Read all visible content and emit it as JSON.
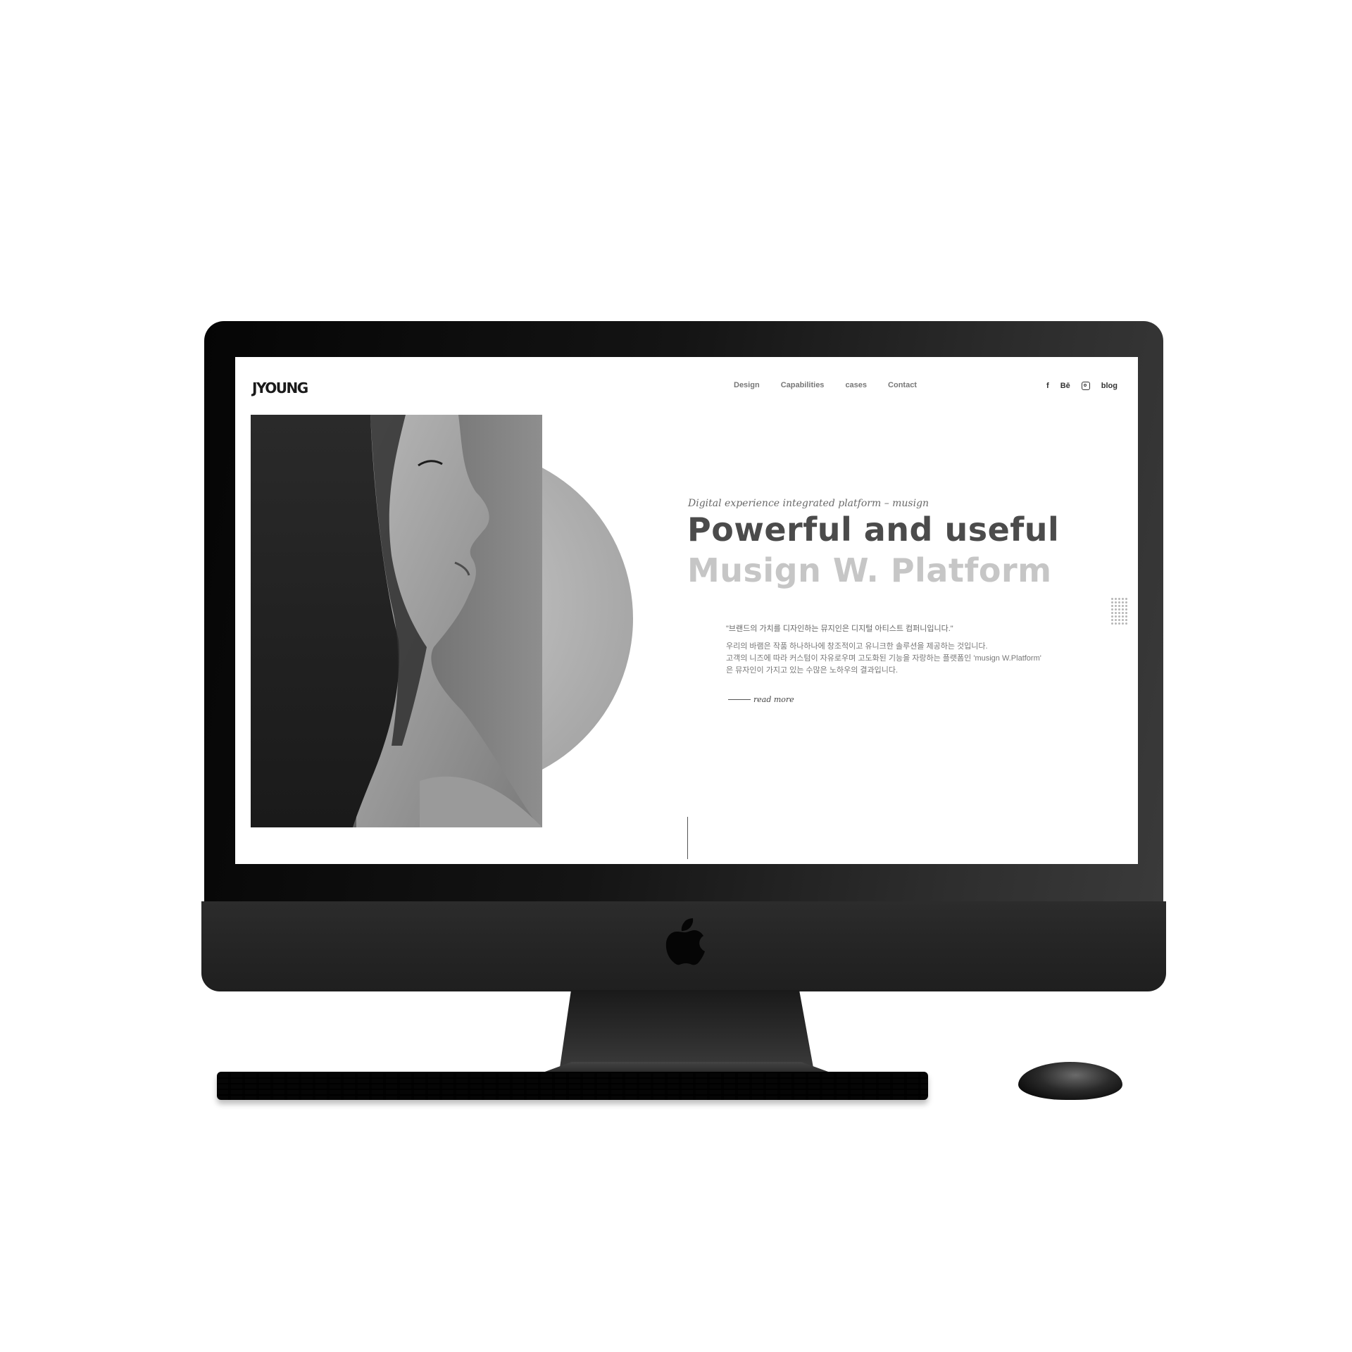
{
  "site": {
    "logo": "JYOUNG",
    "nav": [
      {
        "label": "Design"
      },
      {
        "label": "Capabilities"
      },
      {
        "label": "cases"
      },
      {
        "label": "Contact"
      }
    ],
    "social": {
      "facebook": "f",
      "behance": "Bē",
      "instagram_icon": "instagram-icon",
      "blog": "blog"
    },
    "hero": {
      "tagline": "Digital experience integrated platform – musign",
      "headline_1": "Powerful and useful",
      "headline_2": "Musign W. Platform",
      "quote": "\"브랜드의 가치를 디자인하는 뮤지인은 디지털 아티스트 컴퍼니입니다.\"",
      "description": [
        "우리의 바램은 작품 하나하나에 창조적이고 유니크한 솔루션을 제공하는 것입니다.",
        "고객의 니즈에 따라 커스텀이 자유로우며 고도화된 기능을 자랑하는 플랫폼인 'musign W.Platform'",
        "은 뮤자인이 가지고 있는 수많은 노하우의 결과입니다."
      ],
      "read_more": "read more"
    }
  },
  "device": {
    "type": "iMac",
    "logo_icon": "apple-logo-icon"
  },
  "colors": {
    "heading_dark": "#4b4b4b",
    "heading_light": "#c6c6c6",
    "bezel": "#1a1a1a"
  }
}
